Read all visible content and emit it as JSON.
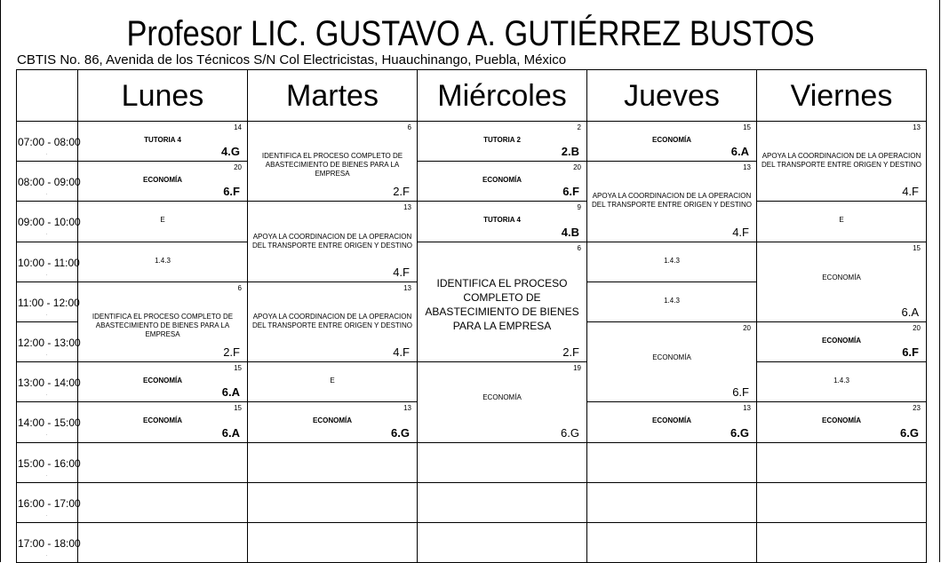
{
  "header": {
    "title": "Profesor LIC. GUSTAVO A. GUTIÉRREZ BUSTOS",
    "subtitle": "CBTIS No. 86, Avenida de los Técnicos S/N Col Electricistas, Huauchinango, Puebla, México"
  },
  "days": [
    "Lunes",
    "Martes",
    "Miércoles",
    "Jueves",
    "Viernes"
  ],
  "times": [
    "07:00 - 08:00",
    "08:00 - 09:00",
    "09:00 - 10:00",
    "10:00 - 11:00",
    "11:00 - 12:00",
    "12:00 - 13:00",
    "13:00 - 14:00",
    "14:00 - 15:00",
    "15:00 - 16:00",
    "16:00 - 17:00",
    "17:00 - 18:00"
  ],
  "time_dot": ".",
  "slots": [
    {
      "day": 0,
      "start": 0,
      "span": 1,
      "room": "14",
      "subject": "TUTORIA 4",
      "group": "4.G",
      "bold": true
    },
    {
      "day": 0,
      "start": 1,
      "span": 1,
      "room": "20",
      "subject": "ECONOMÍA",
      "group": "6.F",
      "bold": true
    },
    {
      "day": 0,
      "start": 2,
      "span": 1,
      "room": "",
      "subject": "E",
      "group": ""
    },
    {
      "day": 0,
      "start": 3,
      "span": 1,
      "room": "",
      "subject": "1.4.3",
      "group": ""
    },
    {
      "day": 0,
      "start": 4,
      "span": 2,
      "room": "6",
      "subject": "IDENTIFICA EL PROCESO COMPLETO DE ABASTECIMIENTO DE BIENES PARA LA EMPRESA",
      "group": "2.F"
    },
    {
      "day": 0,
      "start": 6,
      "span": 1,
      "room": "15",
      "subject": "ECONOMÍA",
      "group": "6.A",
      "bold": true
    },
    {
      "day": 0,
      "start": 7,
      "span": 1,
      "room": "15",
      "subject": "ECONOMÍA",
      "group": "6.A",
      "bold": true
    },
    {
      "day": 0,
      "start": 8,
      "span": 1,
      "room": "",
      "subject": "",
      "group": ""
    },
    {
      "day": 0,
      "start": 9,
      "span": 1,
      "room": "",
      "subject": "",
      "group": ""
    },
    {
      "day": 0,
      "start": 10,
      "span": 1,
      "room": "",
      "subject": "",
      "group": ""
    },
    {
      "day": 1,
      "start": 0,
      "span": 2,
      "room": "6",
      "subject": "IDENTIFICA EL PROCESO COMPLETO DE ABASTECIMIENTO DE BIENES PARA LA EMPRESA",
      "group": "2.F"
    },
    {
      "day": 1,
      "start": 2,
      "span": 2,
      "room": "13",
      "subject": "APOYA LA COORDINACION DE LA OPERACION DEL TRANSPORTE ENTRE ORIGEN Y DESTINO",
      "group": "4.F"
    },
    {
      "day": 1,
      "start": 4,
      "span": 2,
      "room": "13",
      "subject": "APOYA LA COORDINACION DE LA OPERACION DEL TRANSPORTE ENTRE ORIGEN Y DESTINO",
      "group": "4.F"
    },
    {
      "day": 1,
      "start": 6,
      "span": 1,
      "room": "",
      "subject": "E",
      "group": ""
    },
    {
      "day": 1,
      "start": 7,
      "span": 1,
      "room": "13",
      "subject": "ECONOMÍA",
      "group": "6.G",
      "bold": true
    },
    {
      "day": 1,
      "start": 8,
      "span": 1,
      "room": "",
      "subject": "",
      "group": ""
    },
    {
      "day": 1,
      "start": 9,
      "span": 1,
      "room": "",
      "subject": "",
      "group": ""
    },
    {
      "day": 1,
      "start": 10,
      "span": 1,
      "room": "",
      "subject": "",
      "group": ""
    },
    {
      "day": 2,
      "start": 0,
      "span": 1,
      "room": "2",
      "subject": "TUTORIA 2",
      "group": "2.B",
      "bold": true
    },
    {
      "day": 2,
      "start": 1,
      "span": 1,
      "room": "20",
      "subject": "ECONOMÍA",
      "group": "6.F",
      "bold": true
    },
    {
      "day": 2,
      "start": 2,
      "span": 1,
      "room": "9",
      "subject": "TUTORIA 4",
      "group": "4.B",
      "bold": true
    },
    {
      "day": 2,
      "start": 3,
      "span": 3,
      "room": "6",
      "subject": "IDENTIFICA EL PROCESO COMPLETO DE ABASTECIMIENTO DE BIENES PARA LA EMPRESA",
      "group": "2.F",
      "big": true
    },
    {
      "day": 2,
      "start": 6,
      "span": 2,
      "room": "19",
      "subject": "ECONOMÍA",
      "group": "6.G"
    },
    {
      "day": 2,
      "start": 8,
      "span": 1,
      "room": "",
      "subject": "",
      "group": ""
    },
    {
      "day": 2,
      "start": 9,
      "span": 1,
      "room": "",
      "subject": "",
      "group": ""
    },
    {
      "day": 2,
      "start": 10,
      "span": 1,
      "room": "",
      "subject": "",
      "group": ""
    },
    {
      "day": 3,
      "start": 0,
      "span": 1,
      "room": "15",
      "subject": "ECONOMÍA",
      "group": "6.A",
      "bold": true
    },
    {
      "day": 3,
      "start": 1,
      "span": 2,
      "room": "13",
      "subject": "APOYA LA COORDINACION DE LA OPERACION DEL TRANSPORTE ENTRE ORIGEN Y DESTINO",
      "group": "4.F"
    },
    {
      "day": 3,
      "start": 3,
      "span": 1,
      "room": "",
      "subject": "1.4.3",
      "group": ""
    },
    {
      "day": 3,
      "start": 4,
      "span": 1,
      "room": "",
      "subject": "1.4.3",
      "group": ""
    },
    {
      "day": 3,
      "start": 5,
      "span": 2,
      "room": "20",
      "subject": "ECONOMÍA",
      "group": "6.F"
    },
    {
      "day": 3,
      "start": 7,
      "span": 1,
      "room": "13",
      "subject": "ECONOMÍA",
      "group": "6.G",
      "bold": true
    },
    {
      "day": 3,
      "start": 8,
      "span": 1,
      "room": "",
      "subject": "",
      "group": ""
    },
    {
      "day": 3,
      "start": 9,
      "span": 1,
      "room": "",
      "subject": "",
      "group": ""
    },
    {
      "day": 3,
      "start": 10,
      "span": 1,
      "room": "",
      "subject": "",
      "group": ""
    },
    {
      "day": 4,
      "start": 0,
      "span": 2,
      "room": "13",
      "subject": "APOYA LA COORDINACION DE LA OPERACION DEL TRANSPORTE ENTRE ORIGEN Y DESTINO",
      "group": "4.F"
    },
    {
      "day": 4,
      "start": 2,
      "span": 1,
      "room": "",
      "subject": "E",
      "group": ""
    },
    {
      "day": 4,
      "start": 3,
      "span": 2,
      "room": "15",
      "subject": "ECONOMÍA",
      "group": "6.A"
    },
    {
      "day": 4,
      "start": 5,
      "span": 1,
      "room": "20",
      "subject": "ECONOMÍA",
      "group": "6.F",
      "bold": true
    },
    {
      "day": 4,
      "start": 6,
      "span": 1,
      "room": "",
      "subject": "1.4.3",
      "group": ""
    },
    {
      "day": 4,
      "start": 7,
      "span": 1,
      "room": "23",
      "subject": "ECONOMÍA",
      "group": "6.G",
      "bold": true
    },
    {
      "day": 4,
      "start": 8,
      "span": 1,
      "room": "",
      "subject": "",
      "group": ""
    },
    {
      "day": 4,
      "start": 9,
      "span": 1,
      "room": "",
      "subject": "",
      "group": ""
    },
    {
      "day": 4,
      "start": 10,
      "span": 1,
      "room": "",
      "subject": "",
      "group": ""
    }
  ]
}
